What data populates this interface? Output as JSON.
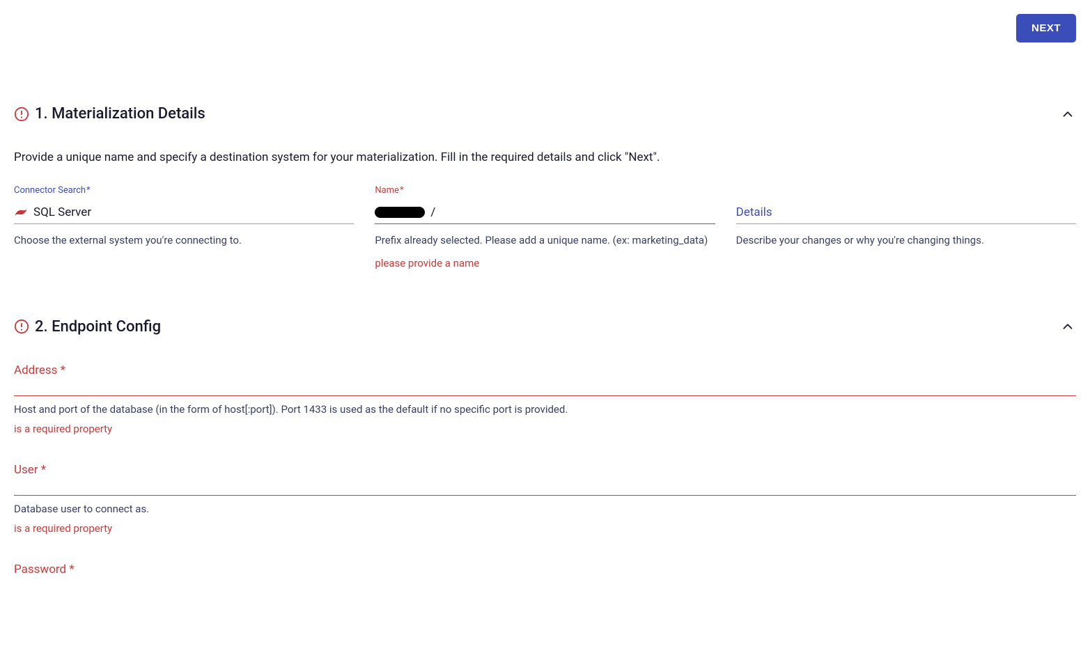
{
  "topbar": {
    "next_label": "NEXT"
  },
  "section1": {
    "title": "1. Materialization Details",
    "description": "Provide a unique name and specify a destination system for your materialization. Fill in the required details and click \"Next\".",
    "connector": {
      "label": "Connector Search",
      "required": "*",
      "value": "SQL Server",
      "helper": "Choose the external system you're connecting to."
    },
    "name": {
      "label": "Name",
      "required": "*",
      "prefix_suffix": "/",
      "helper": "Prefix already selected. Please add a unique name. (ex: marketing_data)",
      "error": "please provide a name"
    },
    "details": {
      "placeholder": "Details",
      "helper": "Describe your changes or why you're changing things."
    }
  },
  "section2": {
    "title": "2. Endpoint Config",
    "address": {
      "label": "Address",
      "required": "*",
      "helper": "Host and port of the database (in the form of host[:port]). Port 1433 is used as the default if no specific port is provided.",
      "error": "is a required property"
    },
    "user": {
      "label": "User",
      "required": "*",
      "helper": "Database user to connect as.",
      "error": "is a required property"
    },
    "password": {
      "label": "Password",
      "required": "*"
    }
  }
}
